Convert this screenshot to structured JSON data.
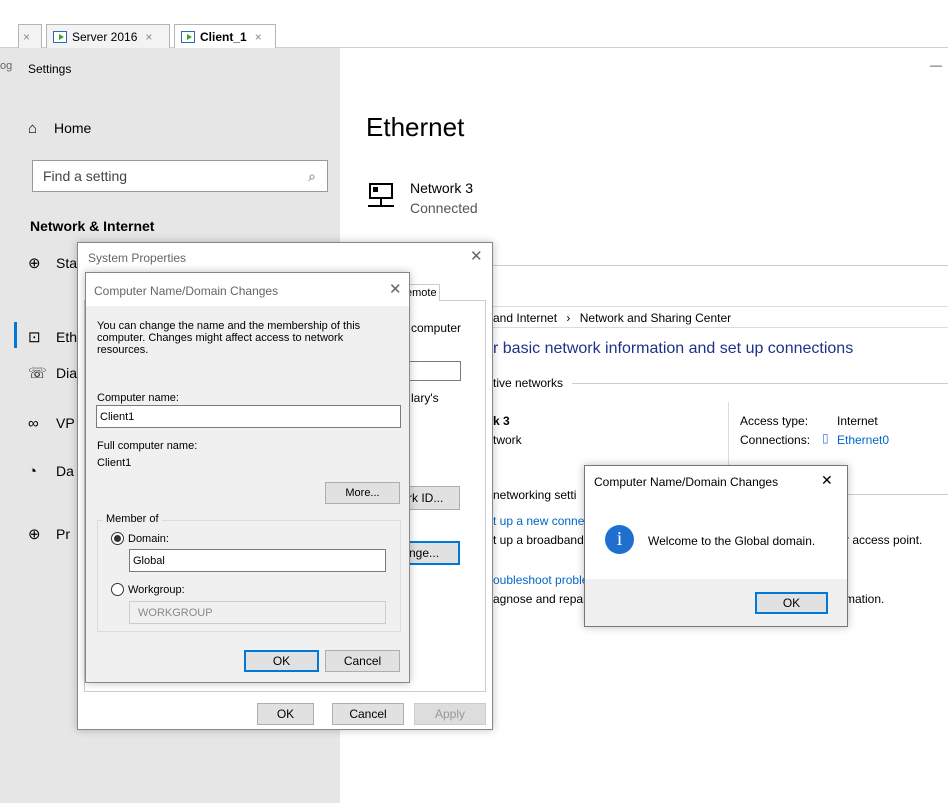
{
  "tabs": [
    {
      "label": ""
    },
    {
      "label": "Server 2016"
    },
    {
      "label": "Client_1"
    }
  ],
  "settings": {
    "window_title": "Settings",
    "home": "Home",
    "search_placeholder": "Find a setting",
    "section": "Network & Internet",
    "nav": [
      {
        "label": "Sta"
      },
      {
        "label": "Eth"
      },
      {
        "label": "Dia"
      },
      {
        "label": "VP"
      },
      {
        "label": "Da"
      },
      {
        "label": "Pr"
      }
    ],
    "minimize": "—"
  },
  "ethernet": {
    "title": "Ethernet",
    "network_name": "Network 3",
    "network_status": "Connected"
  },
  "network_center": {
    "breadcrumb_part1": "and Internet",
    "breadcrumb_sep": "›",
    "breadcrumb_part2": "Network and Sharing Center",
    "heading": "r basic network information and set up connections",
    "active_networks": "tive networks",
    "net_name": "k 3",
    "net_type": "twork",
    "access_type_label": "Access type:",
    "access_type_value": "Internet",
    "connections_label": "Connections:",
    "connections_value": "Ethernet0",
    "change_settings": "networking setti",
    "link1": "t up a new conne",
    "text1": "t up a broadband",
    "text1_tail": "r access point.",
    "link2": "oubleshoot proble",
    "text2": "agnose and repai",
    "text2_tail": "mation."
  },
  "system_properties": {
    "title": "System Properties",
    "tab_remote": "emote",
    "computer_text": "computer",
    "partial_text": "lary's",
    "network_id_btn": "rk ID...",
    "change_btn": "nge...",
    "ok": "OK",
    "cancel": "Cancel",
    "apply": "Apply"
  },
  "name_change": {
    "title": "Computer Name/Domain Changes",
    "description": "You can change the name and the membership of this computer. Changes might affect access to network resources.",
    "computer_name_label": "Computer name:",
    "computer_name_value": "Client1",
    "full_name_label": "Full computer name:",
    "full_name_value": "Client1",
    "more_btn": "More...",
    "member_of": "Member of",
    "domain_label": "Domain:",
    "domain_value": "Global",
    "workgroup_label": "Workgroup:",
    "workgroup_value": "WORKGROUP",
    "ok": "OK",
    "cancel": "Cancel"
  },
  "welcome": {
    "title": "Computer Name/Domain Changes",
    "message": "Welcome to the Global domain.",
    "ok": "OK",
    "close": "✕"
  }
}
